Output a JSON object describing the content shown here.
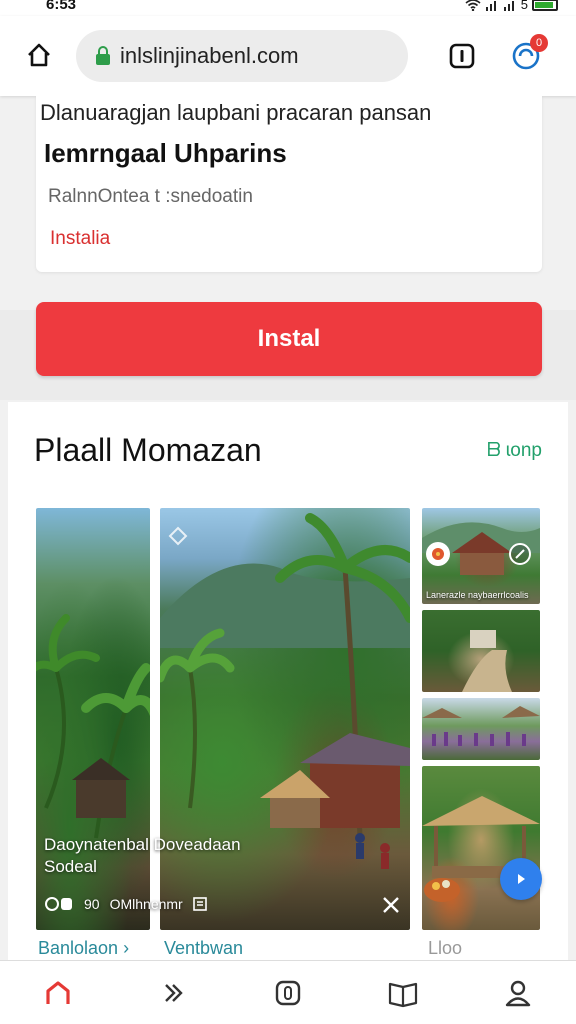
{
  "status_bar": {
    "time": "6:53",
    "battery_text": "5"
  },
  "browser": {
    "url": "inlslinjinabenl.com",
    "notification_count": "0",
    "icons": [
      "home-icon",
      "lock-icon",
      "tabs-icon",
      "profile-icon"
    ]
  },
  "app_card": {
    "subtitle": "Dlanuaragjan laupbani pracaran pansan",
    "title": "Iemrngaal Uhparins",
    "meta": "RalnnOntea t :snedoatin",
    "link": "Instalia"
  },
  "install_button": {
    "label": "Instal",
    "color": "#ee3a3f"
  },
  "section": {
    "title": "Plaall Momazan",
    "more_link": "ᗷ ɩonp",
    "tiles": {
      "main_caption_line1": "Daoynatenbal Doveadaan",
      "main_caption_line2": "Sodeal",
      "main_meta_text": "OMlhnenmr",
      "main_meta_count": "90",
      "small_tile_label": "Lanerazle naybaerrlcoalis"
    },
    "below_labels": [
      "Banlolaon ›",
      "Ventbwan",
      "Lloo"
    ]
  },
  "bottom_nav": {
    "items": [
      "home-icon",
      "forward-icon",
      "tabs-icon",
      "bookmarks-icon",
      "account-icon"
    ],
    "active": "home-icon",
    "active_color": "#e53935"
  }
}
